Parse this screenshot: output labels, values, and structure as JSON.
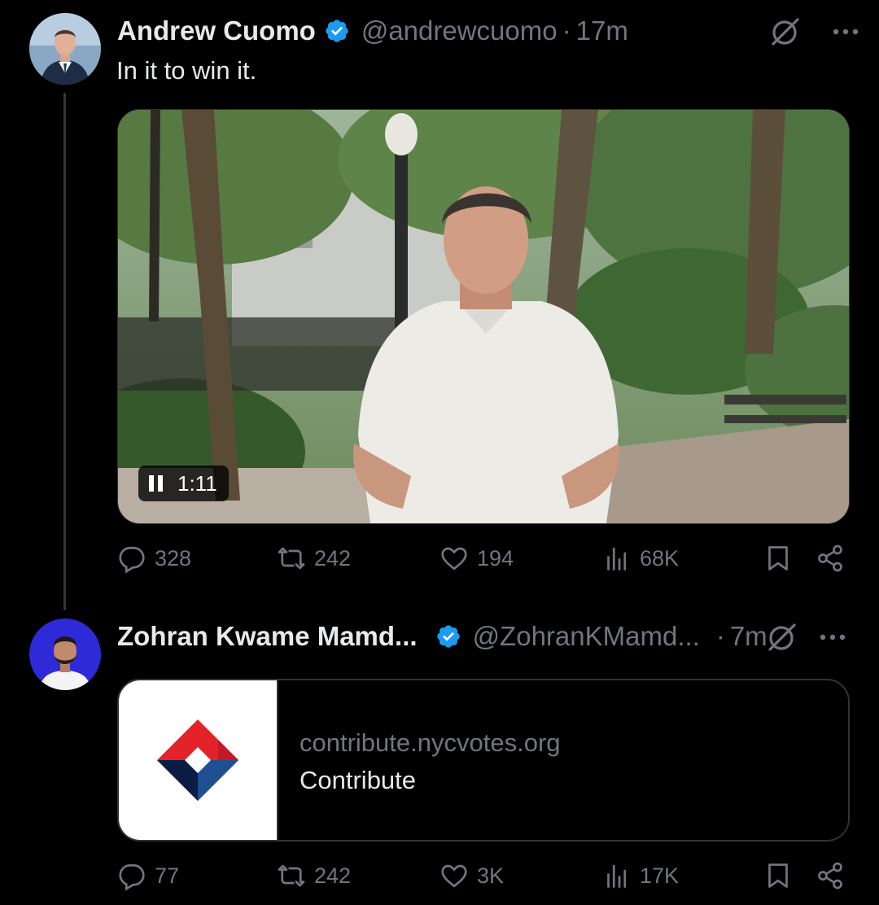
{
  "tweets": [
    {
      "name": "Andrew Cuomo",
      "handle": "@andrewcuomo",
      "separator": "·",
      "time": "17m",
      "text": "In it to win it.",
      "video": {
        "state": "playing",
        "duration": "1:11"
      },
      "stats": {
        "replies": "328",
        "reposts": "242",
        "likes": "194",
        "views": "68K"
      }
    },
    {
      "name": "Zohran Kwame Mamd...",
      "handle": "@ZohranKMamd...",
      "separator": "·",
      "time": "7m",
      "card": {
        "domain": "contribute.nycvotes.org",
        "title": "Contribute"
      },
      "stats": {
        "replies": "77",
        "reposts": "242",
        "likes": "3K",
        "views": "17K"
      }
    }
  ],
  "colors": {
    "background": "#000000",
    "primary_text": "#e7e9ea",
    "secondary_text": "#71767b",
    "verified_blue": "#1d9bf0",
    "border": "#2f3336"
  },
  "icons": [
    "verified-badge-icon",
    "grok-icon",
    "more-icon",
    "pause-icon",
    "reply-icon",
    "repost-icon",
    "like-icon",
    "views-icon",
    "bookmark-icon",
    "share-icon",
    "nycvotes-logo"
  ]
}
